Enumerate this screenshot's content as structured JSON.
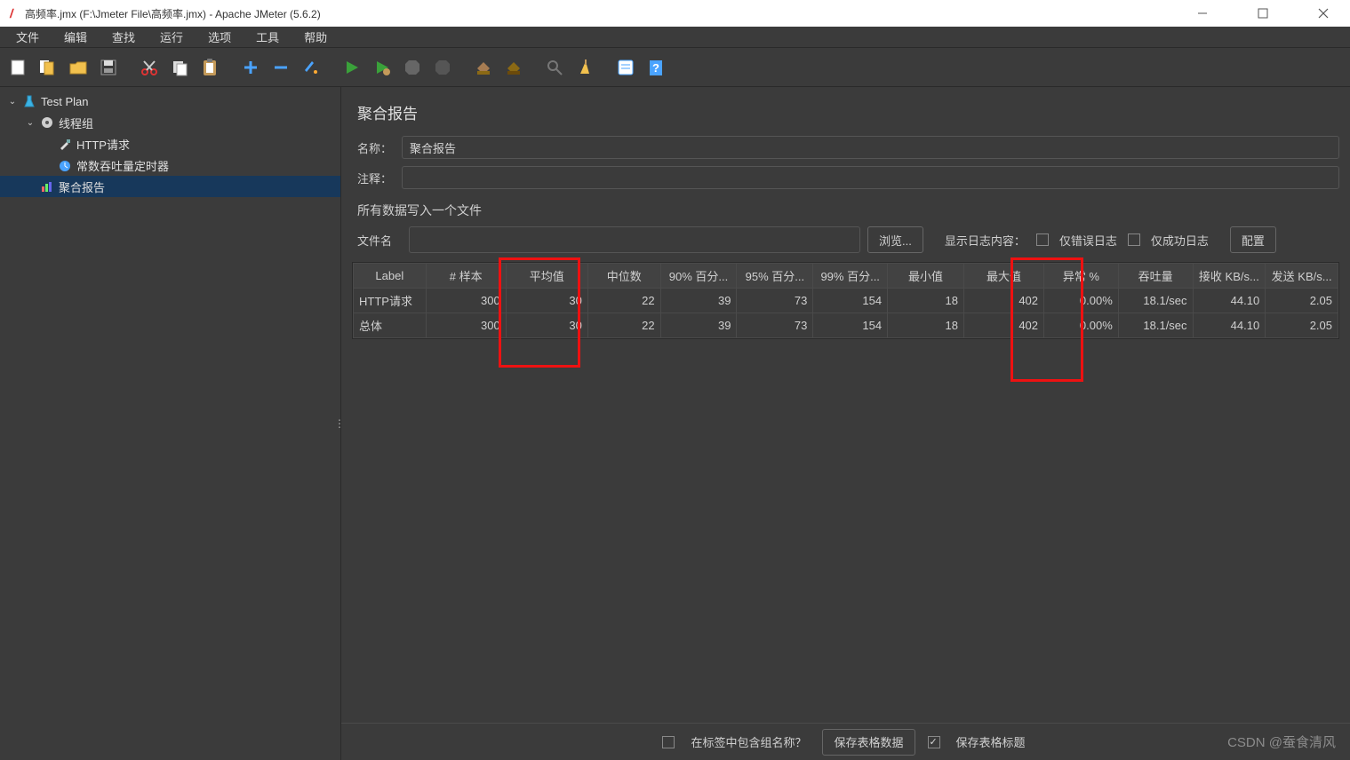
{
  "window": {
    "title": "高频率.jmx (F:\\Jmeter File\\高频率.jmx) - Apache JMeter (5.6.2)"
  },
  "menu": {
    "file": "文件",
    "edit": "编辑",
    "search": "查找",
    "run": "运行",
    "options": "选项",
    "tools": "工具",
    "help": "帮助"
  },
  "tree": {
    "test_plan": "Test Plan",
    "thread_group": "线程组",
    "http_request": "HTTP请求",
    "const_throughput_timer": "常数吞吐量定时器",
    "aggregate_report": "聚合报告"
  },
  "panel": {
    "title": "聚合报告",
    "name_label": "名称：",
    "name_value": "聚合报告",
    "comment_label": "注释：",
    "comment_value": "",
    "write_all_label": "所有数据写入一个文件",
    "filename_label": "文件名",
    "filename_value": "",
    "browse_btn": "浏览...",
    "log_display_label": "显示日志内容：",
    "errors_only": "仅错误日志",
    "success_only": "仅成功日志",
    "configure_btn": "配置"
  },
  "table": {
    "headers": [
      "Label",
      "# 样本",
      "平均值",
      "中位数",
      "90% 百分...",
      "95% 百分...",
      "99% 百分...",
      "最小值",
      "最大值",
      "异常 %",
      "吞吐量",
      "接收 KB/s...",
      "发送 KB/s..."
    ],
    "rows": [
      {
        "label": "HTTP请求",
        "samples": "300",
        "avg": "30",
        "median": "22",
        "p90": "39",
        "p95": "73",
        "p99": "154",
        "min": "18",
        "max": "402",
        "err": "0.00%",
        "tps": "18.1/sec",
        "recv": "44.10",
        "sent": "2.05"
      },
      {
        "label": "总体",
        "samples": "300",
        "avg": "30",
        "median": "22",
        "p90": "39",
        "p95": "73",
        "p99": "154",
        "min": "18",
        "max": "402",
        "err": "0.00%",
        "tps": "18.1/sec",
        "recv": "44.10",
        "sent": "2.05"
      }
    ]
  },
  "footer": {
    "include_group_label": "在标签中包含组名称？",
    "save_table_data": "保存表格数据",
    "save_table_header": "保存表格标题"
  },
  "watermark": "CSDN @蚕食清风"
}
